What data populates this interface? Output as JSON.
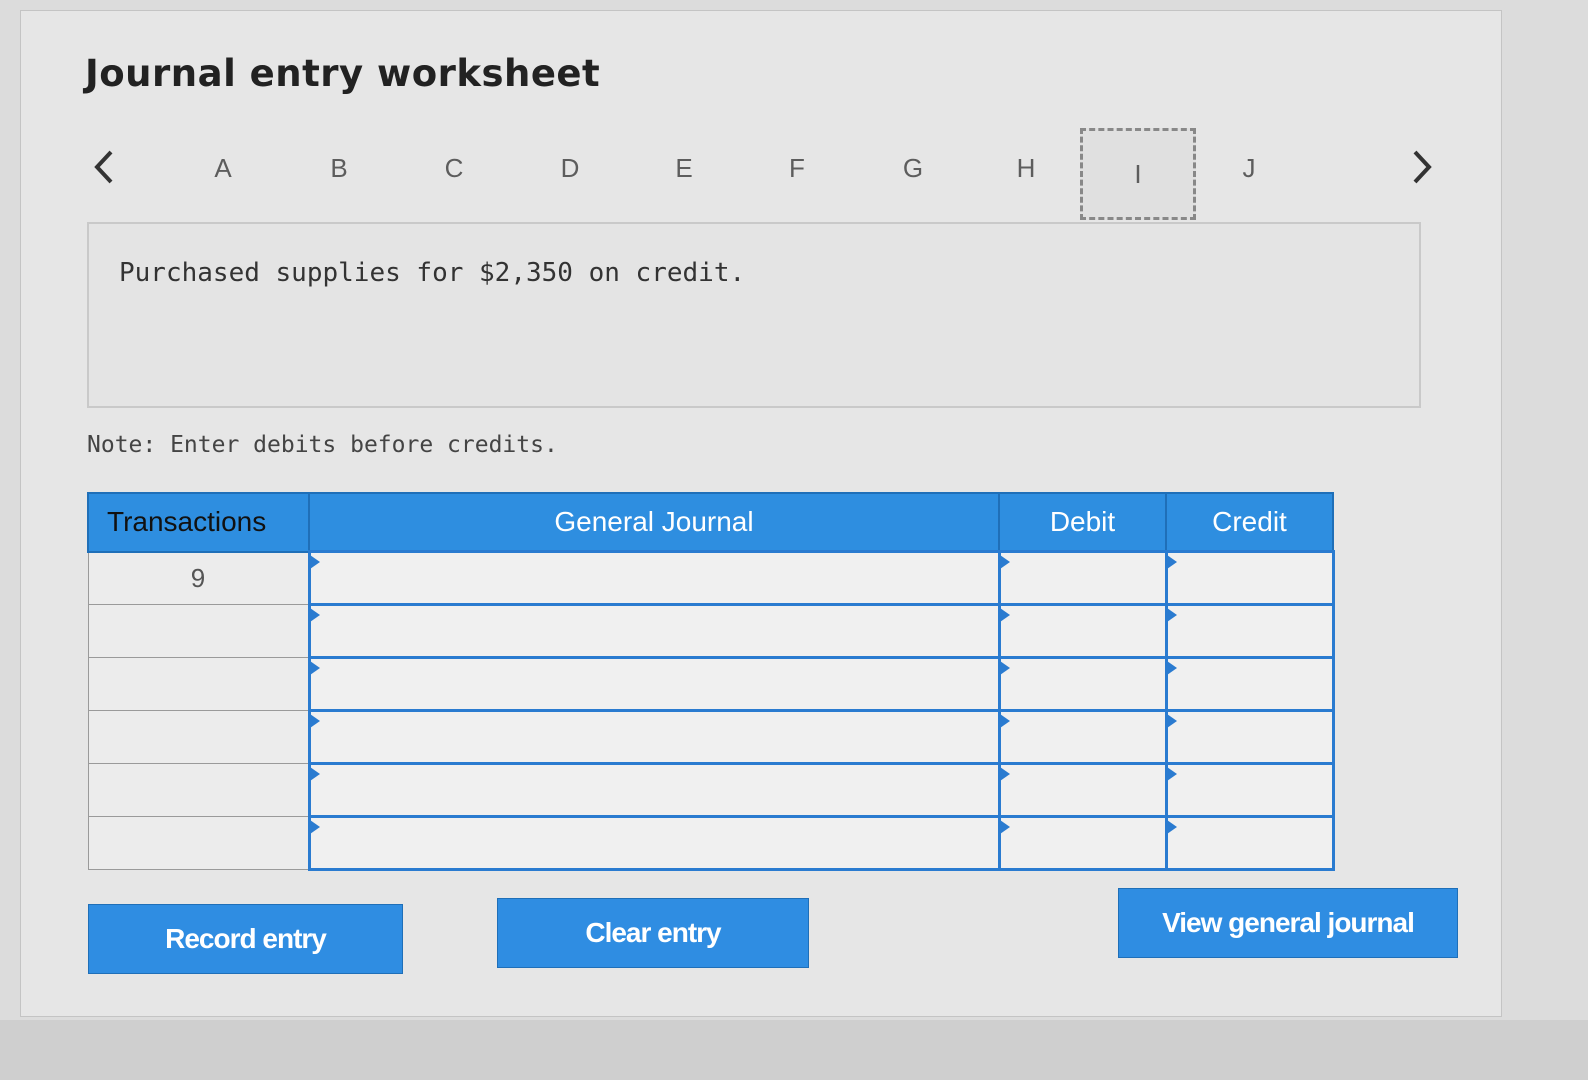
{
  "header": {
    "title": "Journal entry worksheet"
  },
  "nav": {
    "prev_icon": "chevron-left-icon",
    "next_icon": "chevron-right-icon",
    "tabs": [
      {
        "label": "A"
      },
      {
        "label": "B"
      },
      {
        "label": "C"
      },
      {
        "label": "D"
      },
      {
        "label": "E"
      },
      {
        "label": "F"
      },
      {
        "label": "G"
      },
      {
        "label": "H"
      },
      {
        "label": "I",
        "active": true
      },
      {
        "label": "J"
      }
    ]
  },
  "prompt": {
    "text": "Purchased supplies for $2,350 on credit."
  },
  "note": "Note: Enter debits before credits.",
  "journal": {
    "columns": [
      "Transactions",
      "General Journal",
      "Debit",
      "Credit"
    ],
    "rows": [
      {
        "transaction": "9",
        "account": "",
        "debit": "",
        "credit": ""
      },
      {
        "transaction": "",
        "account": "",
        "debit": "",
        "credit": ""
      },
      {
        "transaction": "",
        "account": "",
        "debit": "",
        "credit": ""
      },
      {
        "transaction": "",
        "account": "",
        "debit": "",
        "credit": ""
      },
      {
        "transaction": "",
        "account": "",
        "debit": "",
        "credit": ""
      },
      {
        "transaction": "",
        "account": "",
        "debit": "",
        "credit": ""
      }
    ]
  },
  "buttons": {
    "record": "Record entry",
    "clear": "Clear entry",
    "view": "View general journal"
  },
  "colors": {
    "accent": "#2f8de2",
    "header_bg": "#2e8ee0",
    "grid_border": "#2a7bd0"
  }
}
